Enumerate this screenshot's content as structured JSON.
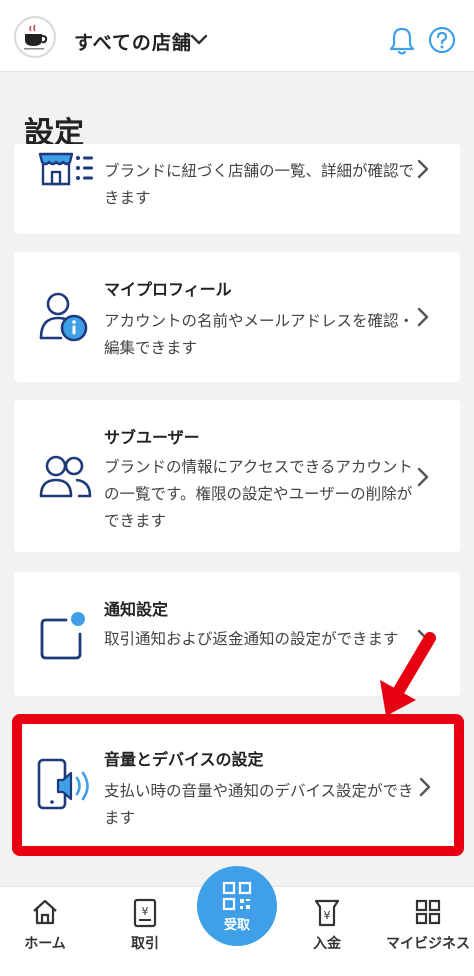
{
  "header": {
    "store_selector": "すべての店舗"
  },
  "page": {
    "title": "設定"
  },
  "cards": [
    {
      "title": "",
      "desc": "ブランドに紐づく店舗の一覧、詳細が確認できます"
    },
    {
      "title": "マイプロフィール",
      "desc": "アカウントの名前やメールアドレスを確認・編集できます"
    },
    {
      "title": "サブユーザー",
      "desc": "ブランドの情報にアクセスできるアカウントの一覧です。権限の設定やユーザーの削除ができます"
    },
    {
      "title": "通知設定",
      "desc": "取引通知および返金通知の設定ができます"
    },
    {
      "title": "音量とデバイスの設定",
      "desc": "支払い時の音量や通知のデバイス設定ができます"
    }
  ],
  "nav": {
    "home": "ホーム",
    "transactions": "取引",
    "receive": "受取",
    "deposit": "入金",
    "my_business": "マイビジネス"
  },
  "colors": {
    "accent": "#3fa0e8",
    "icon_navy": "#1f3a7a",
    "highlight_red": "#e60012"
  }
}
